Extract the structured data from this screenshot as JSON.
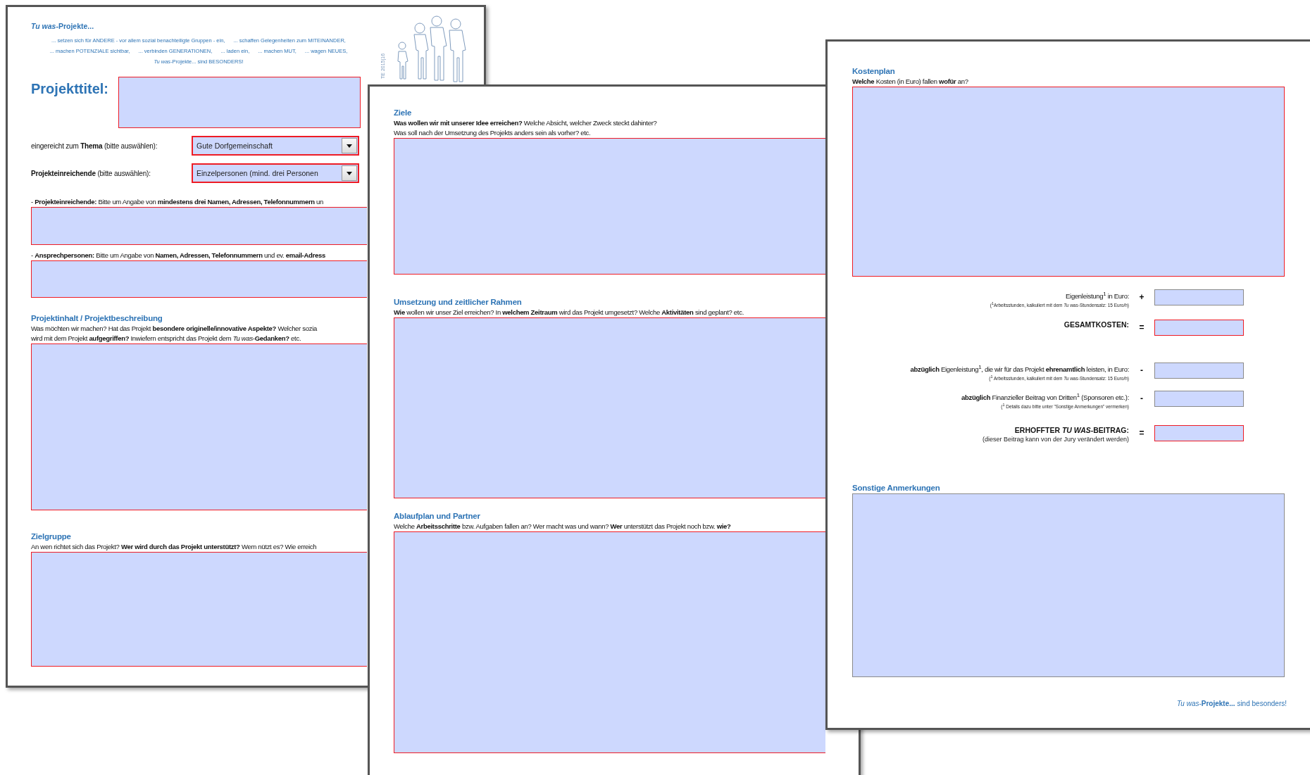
{
  "pages": [
    {
      "brand": "*Tu was*-Projekte...",
      "tagline": [
        [
          "... setzen sich für ANDERE - vor allem sozial benachteiligte Gruppen - ein,",
          "... schaffen Gelegenheiten zum MITEINANDER,"
        ],
        [
          "... machen POTENZIALE sichtbar,",
          "... verbinden GENERATIONEN,",
          "... laden ein,",
          "... machen MUT,",
          "... wagen NEUES,"
        ],
        [
          "*Tu was*-Projekte... sind BESONDERS!"
        ]
      ],
      "side_text": "TE 2015|16",
      "title": {
        "label": "Projekttitel:",
        "required": true
      },
      "selects": [
        {
          "label": "eingereicht zum **Thema** (bitte auswählen):",
          "value": "Gute Dorfgemeinschaft",
          "required": true
        },
        {
          "label": "**Projekteinreichende** (bitte auswählen):",
          "value": "Einzelpersonen (mind. drei Personen",
          "required": true
        }
      ],
      "sections": [
        {
          "lines": [
            "- **Projekteinreichende:** Bitte um Angabe von **mindestens drei Namen, Adressen, Telefonnummern** un"
          ],
          "required": true
        },
        {
          "lines": [
            "- **Ansprechpersonen:** Bitte um Angabe von **Namen, Adressen, Telefonnummern** und ev. **email-Adress**"
          ],
          "required": true
        },
        {
          "heading": "Projektinhalt / Projektbeschreibung",
          "lines": [
            "Was möchten wir machen? Hat das Projekt **besondere originelle/innovative Aspekte?** Welcher sozia",
            "wird mit dem Projekt **aufgegriffen?** Inwiefern entspricht das Projekt dem *Tu was*-**Gedanken?** etc."
          ],
          "required": true
        },
        {
          "heading": "Zielgruppe",
          "lines": [
            "An wen richtet sich das Projekt? **Wer wird durch das Projekt unterstützt?** Wem nützt es? Wie erreich"
          ],
          "required": true
        }
      ]
    },
    {
      "sections": [
        {
          "heading": "Ziele",
          "lines": [
            "**Was wollen wir mit unserer Idee erreichen?** Welche Absicht, welcher Zweck steckt dahinter?",
            "Was soll nach der Umsetzung des Projekts anders sein als vorher?  etc."
          ],
          "required": true
        },
        {
          "heading": "Umsetzung und zeitlicher Rahmen",
          "lines": [
            "**Wie** wollen wir unser Ziel erreichen? In **welchem Zeitraum** wird das Projekt umgesetzt? Welche **Aktivitäten** sind geplant? etc."
          ],
          "required": true
        },
        {
          "heading": "Ablaufplan und Partner",
          "lines": [
            "Welche **Arbeitsschritte** bzw. Aufgaben fallen an? Wer macht was und wann? **Wer** unterstützt das Projekt noch bzw. **wie?**"
          ],
          "required": true
        }
      ]
    },
    {
      "sections": [
        {
          "heading": "Kostenplan",
          "lines": [
            "**Welche** Kosten (in Euro) fallen **wofür** an?"
          ],
          "required": true
        },
        {
          "heading": "Sonstige Anmerkungen",
          "required": false
        }
      ],
      "costs": [
        {
          "kind": "item",
          "label": "Eigenleistung$^{1}$ in Euro:",
          "note": "($^{1}$Arbeitsstunden, kalkuliert mit dem *Tu was*-Stundensatz: 15 Euro/h)",
          "operator": "+",
          "required": false
        },
        {
          "kind": "total",
          "label": "GESAMTKOSTEN:",
          "operator": "=",
          "required": true
        },
        {
          "kind": "item",
          "label": "**abzüglich** Eigenleistung$^{1}$, die wir für das Projekt **ehrenamtlich** leisten, in Euro:",
          "note": "($^{1}$ Arbeitsstunden, kalkuliert mit dem *Tu was*-Stundensatz: 15 Euro/h)",
          "operator": "-",
          "required": false
        },
        {
          "kind": "item",
          "label": "**abzüglich** Finanzieller Beitrag von Dritten$^{1}$ (Sponsoren etc.):",
          "note": "($^{1}$ Details dazu bitte unter \"Sonstige Anmerkungen\" vermerken)",
          "operator": "-",
          "required": false
        },
        {
          "kind": "total",
          "label": "ERHOFFTER *TU WAS*-BEITRAG:",
          "note": "(dieser Beitrag kann von der Jury verändert werden)",
          "operator": "=",
          "required": true
        }
      ],
      "footer": "*Tu was*-**Projekte...** sind besonders!"
    }
  ]
}
